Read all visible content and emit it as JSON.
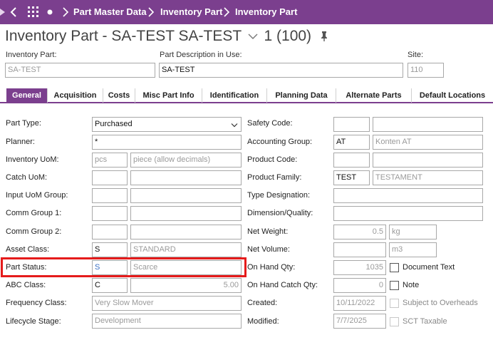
{
  "breadcrumb": {
    "items": [
      "Part Master Data",
      "Inventory Part",
      "Inventory Part"
    ]
  },
  "header": {
    "title": "Inventory Part - SA-TEST SA-TEST",
    "record_position": "1 (100)",
    "inventory_part_label": "Inventory Part:",
    "inventory_part_value": "SA-TEST",
    "description_label": "Part Description in Use:",
    "description_value": "SA-TEST",
    "site_label": "Site:",
    "site_value": "110"
  },
  "tabs": [
    "General",
    "Acquisition",
    "Costs",
    "Misc Part Info",
    "Identification",
    "Planning Data",
    "Alternate Parts",
    "Default Locations"
  ],
  "left_form": {
    "part_type_label": "Part Type:",
    "part_type_value": "Purchased",
    "planner_label": "Planner:",
    "planner_value": "*",
    "inventory_uom_label": "Inventory UoM:",
    "inventory_uom_code": "pcs",
    "inventory_uom_desc": "piece (allow decimals)",
    "catch_uom_label": "Catch UoM:",
    "input_uom_group_label": "Input UoM Group:",
    "comm_group1_label": "Comm Group 1:",
    "comm_group2_label": "Comm Group 2:",
    "asset_class_label": "Asset Class:",
    "asset_class_code": "S",
    "asset_class_desc": "STANDARD",
    "part_status_label": "Part Status:",
    "part_status_code": "S",
    "part_status_desc": "Scarce",
    "abc_class_label": "ABC Class:",
    "abc_class_code": "C",
    "abc_class_value": "5.00",
    "frequency_class_label": "Frequency Class:",
    "frequency_class_value": "Very Slow Mover",
    "lifecycle_stage_label": "Lifecycle Stage:",
    "lifecycle_stage_value": "Development"
  },
  "right_form": {
    "safety_code_label": "Safety Code:",
    "accounting_group_label": "Accounting Group:",
    "accounting_group_code": "AT",
    "accounting_group_desc": "Konten AT",
    "product_code_label": "Product Code:",
    "product_family_label": "Product Family:",
    "product_family_code": "TEST",
    "product_family_desc": "TESTAMENT",
    "type_designation_label": "Type Designation:",
    "dimension_quality_label": "Dimension/Quality:",
    "net_weight_label": "Net Weight:",
    "net_weight_value": "0.5",
    "net_weight_unit": "kg",
    "net_volume_label": "Net Volume:",
    "net_volume_unit": "m3",
    "on_hand_qty_label": "On Hand Qty:",
    "on_hand_qty_value": "1035",
    "on_hand_catch_qty_label": "On Hand Catch Qty:",
    "on_hand_catch_qty_value": "0",
    "created_label": "Created:",
    "created_value": "10/11/2022",
    "modified_label": "Modified:",
    "modified_value": "7/7/2025"
  },
  "checkboxes": {
    "document_text": "Document Text",
    "note": "Note",
    "subject_to_overheads": "Subject to Overheads",
    "sct_taxable": "SCT Taxable"
  },
  "colors": {
    "brand": "#7b3f8e",
    "highlight": "#e51b1b"
  }
}
